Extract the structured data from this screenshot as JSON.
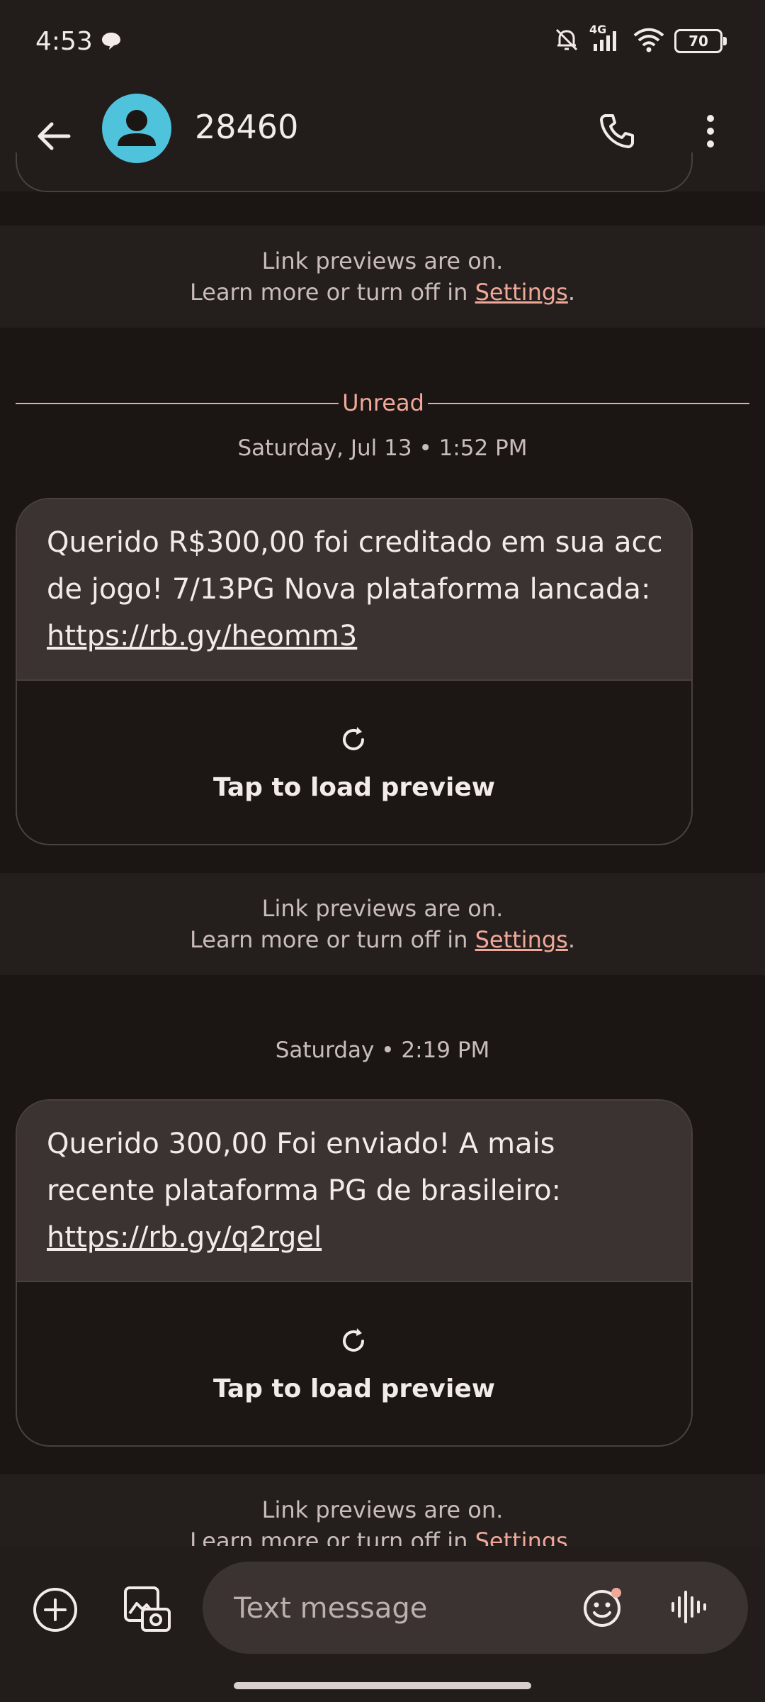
{
  "status_bar": {
    "time": "4:53",
    "network": "4G",
    "battery": "70"
  },
  "app_bar": {
    "contact_name": "28460"
  },
  "link_preview_notice": {
    "line1": "Link previews are on.",
    "line2_prefix": "Learn more or turn off in ",
    "link": "Settings",
    "line2_suffix": "."
  },
  "unread_label": "Unread",
  "messages": [
    {
      "timestamp": "Saturday, Jul 13 • 1:52 PM",
      "text": "Querido R$300,00 foi creditado em sua acc de jogo!  7/13PG Nova plataforma lancada: ",
      "link": "https://rb.gy/heomm3",
      "preview_label": "Tap to load preview"
    },
    {
      "timestamp": "Saturday • 2:19 PM",
      "text": "Querido 300,00 Foi enviado!  A mais recente plataforma PG de brasileiro: ",
      "link": "https://rb.gy/q2rgel",
      "preview_label": "Tap to load preview"
    }
  ],
  "compose": {
    "placeholder": "Text message"
  },
  "colors": {
    "accent": "#f0a899",
    "avatar": "#4fc3dc",
    "background": "#1b1514"
  }
}
